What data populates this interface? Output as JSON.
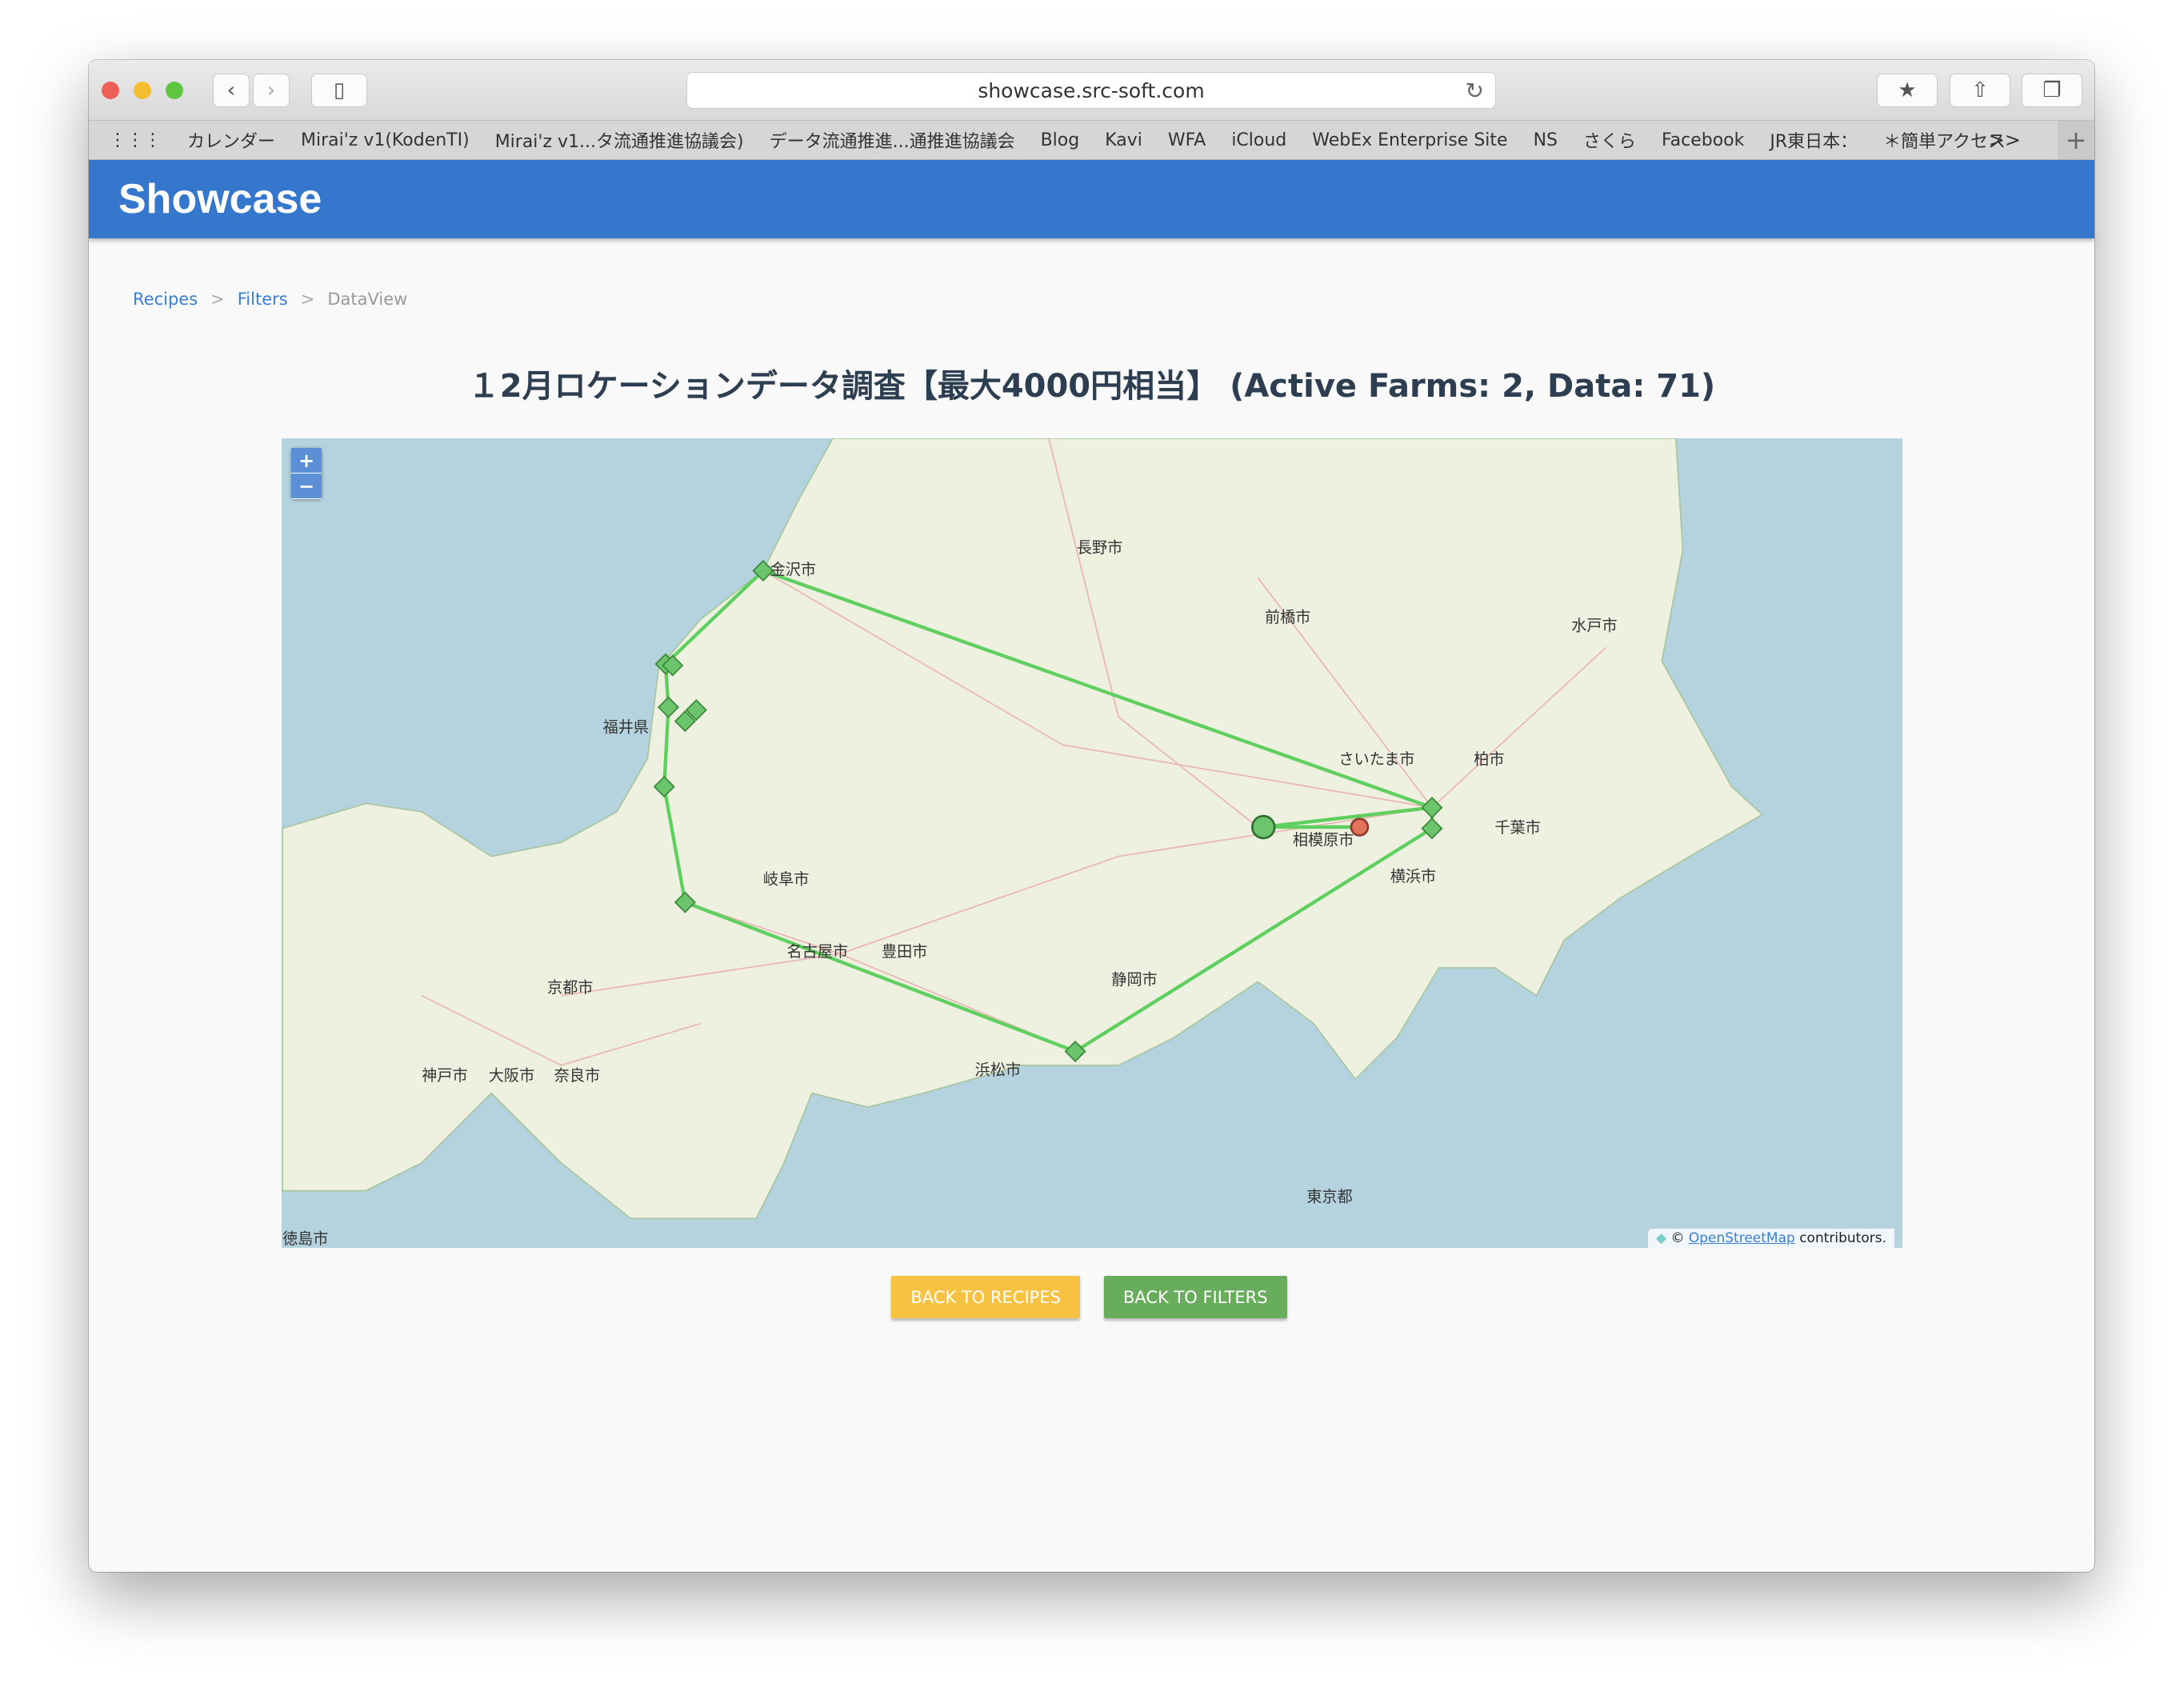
{
  "browser": {
    "url": "showcase.src-soft.com",
    "bookmarks": [
      "カレンダー",
      "Mirai'z v1(KodenTI)",
      "Mirai'z v1...タ流通推進協議会)",
      "データ流通推進...通推進協議会",
      "Blog",
      "Kavi",
      "WFA",
      "iCloud",
      "WebEx Enterprise Site",
      "NS",
      "さくら",
      "Facebook",
      "JR東日本：",
      "＊簡単アクセス"
    ],
    "more": ">>",
    "add": "+"
  },
  "header": {
    "title": "Showcase",
    "color": "#3477cc"
  },
  "breadcrumb": [
    {
      "label": "Recipes"
    },
    {
      "label": "Filters"
    },
    {
      "label": "DataView"
    }
  ],
  "breadcrumb_sep": ">",
  "page": {
    "title": "１2月ロケーションデータ調査【最大4000円相当】 (Active Farms: 2, Data: 71)"
  },
  "map": {
    "zoom_in": "+",
    "zoom_out": "−",
    "attribution_prefix": "©",
    "attribution_link": "OpenStreetMap",
    "attribution_suffix": "contributors.",
    "labels": [
      "金沢市",
      "長野市",
      "前橋市",
      "さいたま市",
      "千葉市",
      "横浜市",
      "相模原市",
      "静岡市",
      "浜松市",
      "名古屋市",
      "豊田市",
      "岐阜市",
      "京都市",
      "大阪市",
      "神戸市",
      "奈良市",
      "水戸市",
      "柏市",
      "徳島市",
      "福井県",
      "東京都"
    ],
    "route_color": "#5fcf5f",
    "marker_colors": {
      "farm_a": "#6cc46c",
      "farm_b": "#e0735a"
    }
  },
  "actions": {
    "back_recipes": "BACK TO RECIPES",
    "back_filters": "BACK TO FILTERS",
    "recipes_color": "#f7c242",
    "filters_color": "#68ad5c"
  }
}
